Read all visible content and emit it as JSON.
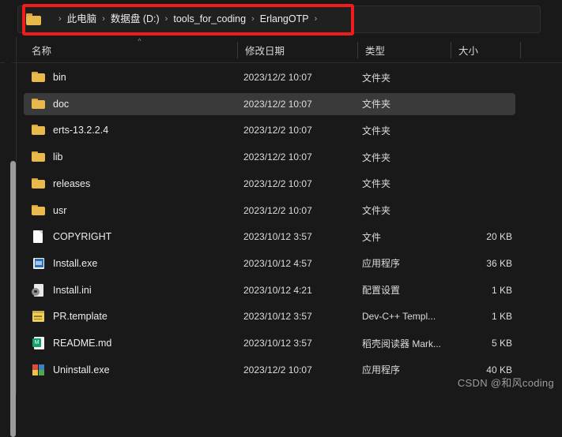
{
  "window": {
    "background_color": "#191919",
    "accent_color": "#f01b1b"
  },
  "address_bar": {
    "folder_icon": "folder-icon",
    "crumbs": [
      "此电脑",
      "数据盘 (D:)",
      "tools_for_coding",
      "ErlangOTP"
    ],
    "separator": "›",
    "trailing_separator": "›",
    "highlighted": true
  },
  "columns": {
    "headers": [
      "名称",
      "修改日期",
      "类型",
      "大小"
    ],
    "sort_column": "名称",
    "sort_indicator": "^"
  },
  "files": [
    {
      "name": "bin",
      "date": "2023/12/2 10:07",
      "type": "文件夹",
      "size": "",
      "icon": "folder-icon",
      "selected": false
    },
    {
      "name": "doc",
      "date": "2023/12/2 10:07",
      "type": "文件夹",
      "size": "",
      "icon": "folder-icon",
      "selected": true
    },
    {
      "name": "erts-13.2.2.4",
      "date": "2023/12/2 10:07",
      "type": "文件夹",
      "size": "",
      "icon": "folder-icon",
      "selected": false
    },
    {
      "name": "lib",
      "date": "2023/12/2 10:07",
      "type": "文件夹",
      "size": "",
      "icon": "folder-icon",
      "selected": false
    },
    {
      "name": "releases",
      "date": "2023/12/2 10:07",
      "type": "文件夹",
      "size": "",
      "icon": "folder-icon",
      "selected": false
    },
    {
      "name": "usr",
      "date": "2023/12/2 10:07",
      "type": "文件夹",
      "size": "",
      "icon": "folder-icon",
      "selected": false
    },
    {
      "name": "COPYRIGHT",
      "date": "2023/10/12 3:57",
      "type": "文件",
      "size": "20 KB",
      "icon": "page-icon",
      "selected": false
    },
    {
      "name": "Install.exe",
      "date": "2023/10/12 4:57",
      "type": "应用程序",
      "size": "36 KB",
      "icon": "application-icon",
      "selected": false
    },
    {
      "name": "Install.ini",
      "date": "2023/10/12 4:21",
      "type": "配置设置",
      "size": "1 KB",
      "icon": "settings-file-icon",
      "selected": false
    },
    {
      "name": "PR.template",
      "date": "2023/10/12 3:57",
      "type": "Dev-C++ Templ...",
      "size": "1 KB",
      "icon": "template-file-icon",
      "selected": false
    },
    {
      "name": "README.md",
      "date": "2023/10/12 3:57",
      "type": "稻壳阅读器 Mark...",
      "size": "5 KB",
      "icon": "markdown-file-icon",
      "selected": false
    },
    {
      "name": "Uninstall.exe",
      "date": "2023/12/2 10:07",
      "type": "应用程序",
      "size": "40 KB",
      "icon": "uninstall-icon",
      "selected": false
    }
  ],
  "watermark": {
    "text": "CSDN @和风coding"
  },
  "scrollbar": {
    "orientation": "vertical"
  }
}
